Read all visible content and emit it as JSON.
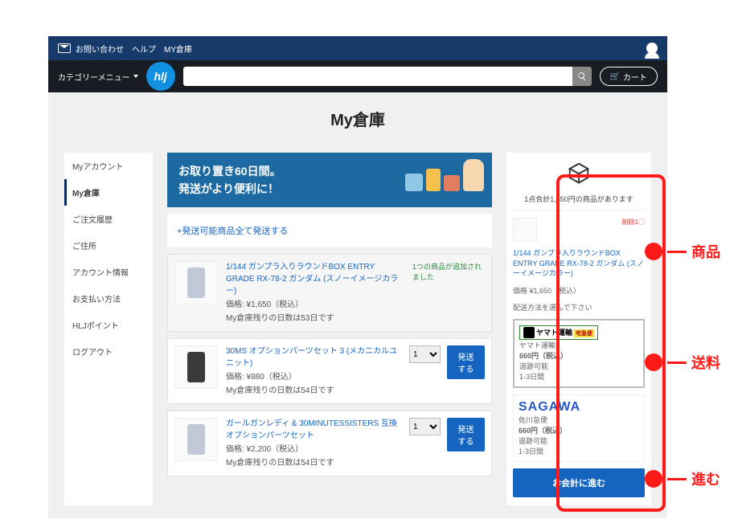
{
  "topbar": {
    "contact": "お問い合わせ",
    "help": "ヘルプ",
    "mywh": "MY倉庫"
  },
  "navbar": {
    "category": "カテゴリーメニュー",
    "logo": "hlj",
    "search_placeholder": "",
    "cart_label": "カート"
  },
  "page_title": "My倉庫",
  "sidebar": {
    "items": [
      {
        "label": "Myアカウント"
      },
      {
        "label": "My倉庫"
      },
      {
        "label": "ご注文履歴"
      },
      {
        "label": "ご住所"
      },
      {
        "label": "アカウント情報"
      },
      {
        "label": "お支払い方法"
      },
      {
        "label": "HLJポイント"
      },
      {
        "label": "ログアウト"
      }
    ],
    "active_index": 1
  },
  "banner": {
    "line1": "お取り置き60日間。",
    "line2": "発送がより便利に！"
  },
  "ship_all_link": "+発送可能商品全て発送する",
  "added_tag": "1つの商品が追加されました",
  "products": [
    {
      "name": "1/144 ガンプラ入りラウンドBOX ENTRY GRADE RX-78-2 ガンダム (スノーイメージカラー)",
      "price": "価格: ¥1,650（税込）",
      "days": "My倉庫残りの日数は53日です",
      "added": true,
      "qty": null
    },
    {
      "name": "30MS オプションパーツセット 3 (メカニカルユニット)",
      "price": "価格: ¥880（税込）",
      "days": "My倉庫残りの日数は54日です",
      "added": false,
      "qty": "1",
      "ship_label": "発送する"
    },
    {
      "name": "ガールガンレディ & 30MINUTESSISTERS 互換オプションパーツセット",
      "price": "価格: ¥2,200（税込）",
      "days": "My倉庫残りの日数は54日です",
      "added": false,
      "qty": "1",
      "ship_label": "発送する"
    }
  ],
  "checkout": {
    "summary": "1点合計1,650円の商品があります",
    "del_label": "削除1◯",
    "item": {
      "name": "1/144 ガンプラ入りラウンドBOX ENTRY GRADE RX-78-2 ガンダム (スノーイメージカラー)",
      "price": "価格 ¥1,650（税込）"
    },
    "ship_prompt": "配送方法を選んで下さい",
    "methods": [
      {
        "carrier": "ヤマト運輸",
        "logo_text": "ヤマト運輸",
        "tag": "宅急便",
        "price": "660円（税込）",
        "track": "追跡可能",
        "eta": "1-3日間"
      },
      {
        "carrier": "佐川急便",
        "logo_text": "SAGAWA",
        "price": "660円（税込）",
        "track": "追跡可能",
        "eta": "1-3日間"
      }
    ],
    "proceed": "お会計に進む"
  },
  "callouts": {
    "product": "商品",
    "shipping": "送料",
    "proceed": "進む"
  }
}
